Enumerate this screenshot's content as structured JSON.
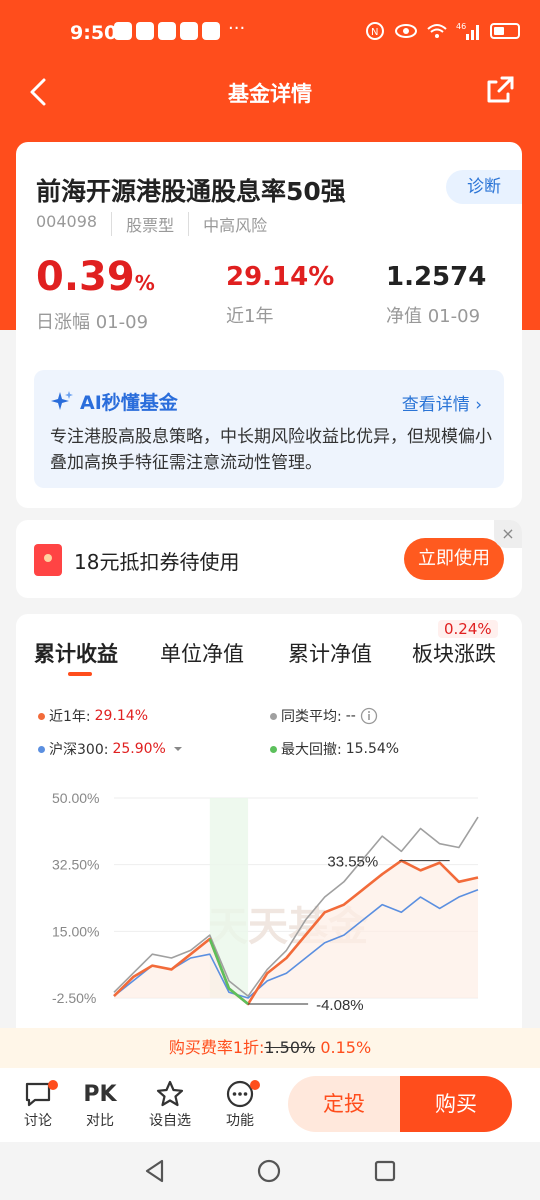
{
  "status": {
    "time": "9:50",
    "more": "···",
    "network": "46"
  },
  "nav": {
    "title": "基金详情"
  },
  "fund": {
    "name": "前海开源港股通股息率50强",
    "diagnose": "诊断",
    "code": "004098",
    "type": "股票型",
    "risk": "中高风险",
    "daily_change": "0.39",
    "daily_change_unit": "%",
    "daily_label": "日涨幅 01-09",
    "year_return": "29.14%",
    "year_label": "近1年",
    "nav_value": "1.2574",
    "nav_label": "净值 01-09"
  },
  "ai": {
    "title": "AI秒懂基金",
    "more": "查看详情 ›",
    "text": "专注港股高股息策略，中长期风险收益比优异，但规模偏小叠加高换手特征需注意流动性管理。"
  },
  "coupon": {
    "text": "18元抵扣券待使用",
    "button": "立即使用",
    "close": "×"
  },
  "tabs": [
    {
      "label": "累计收益"
    },
    {
      "label": "单位净值"
    },
    {
      "label": "累计净值"
    },
    {
      "label": "板块涨跌",
      "badge": "0.24%"
    }
  ],
  "legend": {
    "fund_label": "近1年:",
    "fund_value": "29.14%",
    "peer_label": "同类平均:",
    "peer_value": "--",
    "index_label": "沪深300:",
    "index_value": "25.90%",
    "drawdown_label": "最大回撤:",
    "drawdown_value": "15.54%"
  },
  "colors": {
    "fund": "#f26b3a",
    "peer": "#a0a0a0",
    "index": "#5b8fe0",
    "drawdown": "#5cc05c"
  },
  "chart_data": {
    "type": "line",
    "ylim": [
      -2.5,
      50
    ],
    "ytick_labels": [
      "50.00%",
      "32.50%",
      "15.00%",
      "-2.50%"
    ],
    "annotations": [
      "33.55%",
      "-4.08%"
    ],
    "watermark": "天天基金",
    "series": [
      {
        "name": "近1年",
        "values": [
          -2,
          3,
          6,
          5,
          9,
          13,
          0,
          -4.08,
          4,
          8,
          14,
          20,
          22,
          26,
          30,
          33.55,
          31,
          33,
          28,
          29.14
        ]
      },
      {
        "name": "同类平均",
        "values": [
          -1,
          4,
          9,
          8,
          10,
          14,
          2,
          -2,
          5,
          10,
          18,
          24,
          28,
          34,
          40,
          36,
          42,
          38,
          37,
          45
        ]
      },
      {
        "name": "沪深300",
        "values": [
          -2,
          2,
          6,
          5,
          8,
          9,
          -1,
          -2.5,
          2,
          4,
          8,
          12,
          14,
          18,
          22,
          20,
          24,
          21,
          24,
          25.9
        ]
      }
    ]
  },
  "fee": {
    "prefix": "购买费率1折:",
    "old": "1.50%",
    "new": "0.15%"
  },
  "bottom": [
    {
      "label": "讨论",
      "icon": "chat-icon"
    },
    {
      "label": "对比",
      "icon": "PK"
    },
    {
      "label": "设自选",
      "icon": "star-icon"
    },
    {
      "label": "功能",
      "icon": "more-icon"
    }
  ],
  "buttons": {
    "dingtou": "定投",
    "buy": "购买"
  }
}
